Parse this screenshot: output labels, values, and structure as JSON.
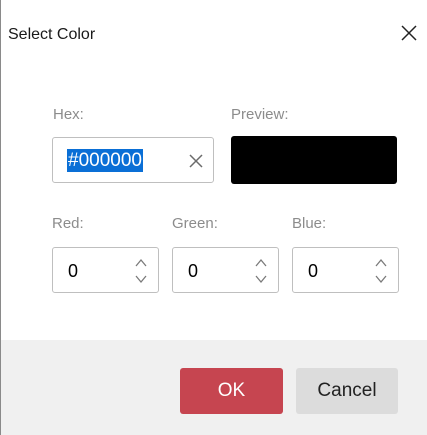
{
  "dialog": {
    "title": "Select Color"
  },
  "hex": {
    "label": "Hex:",
    "value": "#000000"
  },
  "preview": {
    "label": "Preview:",
    "color": "#000000"
  },
  "channels": {
    "red": {
      "label": "Red:",
      "value": "0"
    },
    "green": {
      "label": "Green:",
      "value": "0"
    },
    "blue": {
      "label": "Blue:",
      "value": "0"
    }
  },
  "buttons": {
    "ok": "OK",
    "cancel": "Cancel"
  },
  "icons": {
    "close": "close-icon",
    "clear": "clear-icon",
    "up": "chevron-up-icon",
    "down": "chevron-down-icon"
  },
  "colors": {
    "ok_button": "#c64550",
    "selection": "#0a6fd6",
    "footer": "#f0f0f0"
  }
}
